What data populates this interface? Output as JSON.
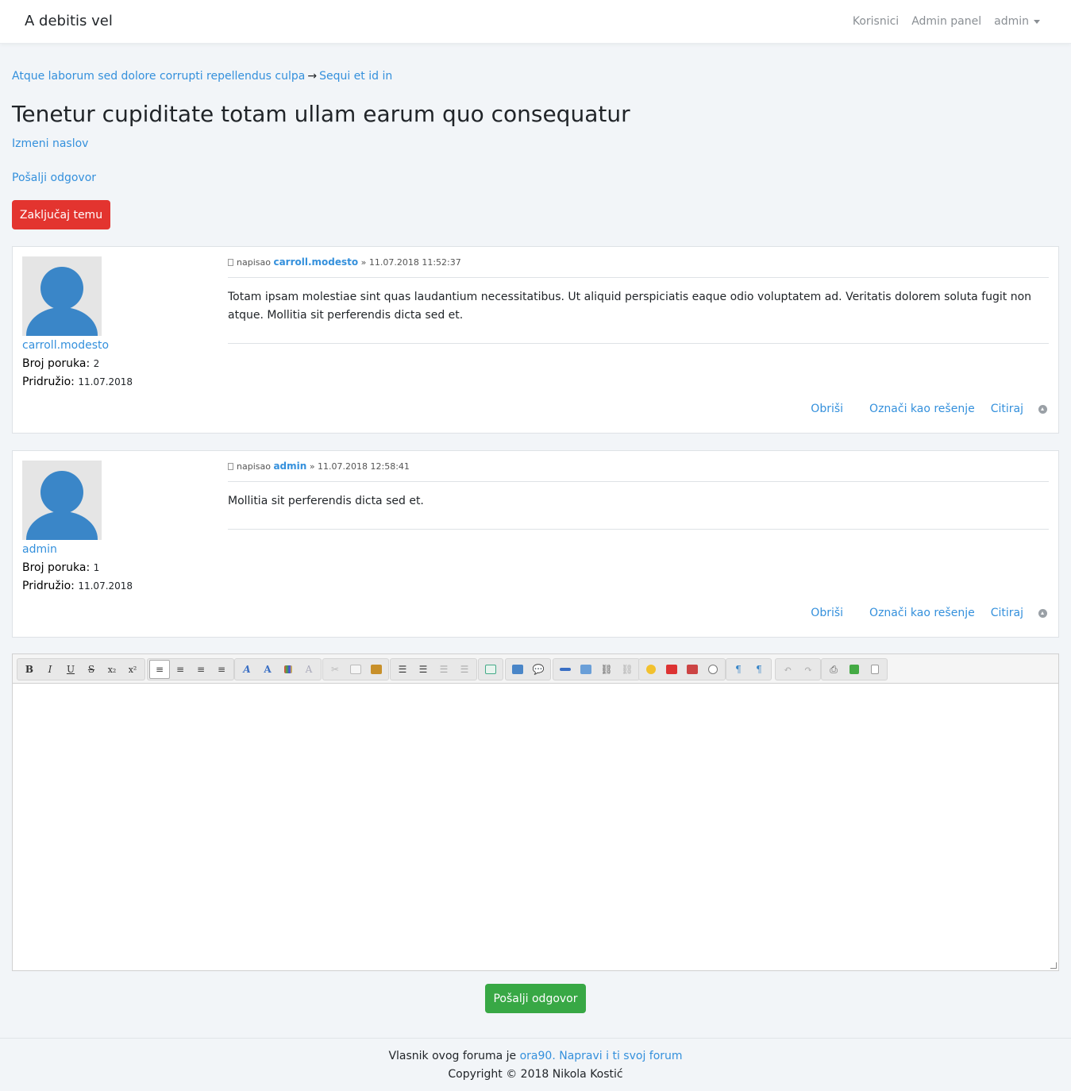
{
  "navbar": {
    "brand": "A debitis vel",
    "links": [
      "Korisnici",
      "Admin panel"
    ],
    "user": "admin"
  },
  "breadcrumb": {
    "parent": "Atque laborum sed dolore corrupti repellendus culpa",
    "arrow": "→",
    "current": "Sequi et id in"
  },
  "topic": {
    "title": "Tenetur cupiditate totam ullam earum quo consequatur",
    "edit_title": "Izmeni naslov",
    "send_reply_link": "Pošalji odgovor",
    "lock_button": "Zaključaj temu"
  },
  "labels": {
    "wrote": "napisao",
    "sep": "»",
    "msg_count": "Broj poruka:",
    "joined": "Pridružio:",
    "delete": "Obriši",
    "mark_solution": "Označi kao rešenje",
    "quote": "Citiraj"
  },
  "posts": [
    {
      "author": "carroll.modesto",
      "date": "11.07.2018 11:52:37",
      "text": "Totam ipsam molestiae sint quas laudantium necessitatibus. Ut aliquid perspiciatis eaque odio voluptatem ad. Veritatis dolorem soluta fugit non atque. Mollitia sit perferendis dicta sed et.",
      "msg_count": "2",
      "joined": "11.07.2018"
    },
    {
      "author": "admin",
      "date": "11.07.2018 12:58:41",
      "text": "Mollitia sit perferendis dicta sed et.",
      "msg_count": "1",
      "joined": "11.07.2018"
    }
  ],
  "editor": {
    "toolbar": {
      "bold": "B",
      "italic": "I",
      "underline": "U",
      "strike": "S",
      "sub": "x₂",
      "sup": "x²"
    },
    "content": ""
  },
  "submit_button": "Pošalji odgovor",
  "footer": {
    "owner_text": "Vlasnik ovog foruma je",
    "owner": "ora90.",
    "make_forum": "Napravi i ti svoj forum",
    "copyright": "Copyright © 2018 Nikola Kostić"
  },
  "colors": {
    "primary": "#3490dc",
    "danger": "#e3342f",
    "success": "#38a845",
    "avatar": "#3a86c8"
  }
}
